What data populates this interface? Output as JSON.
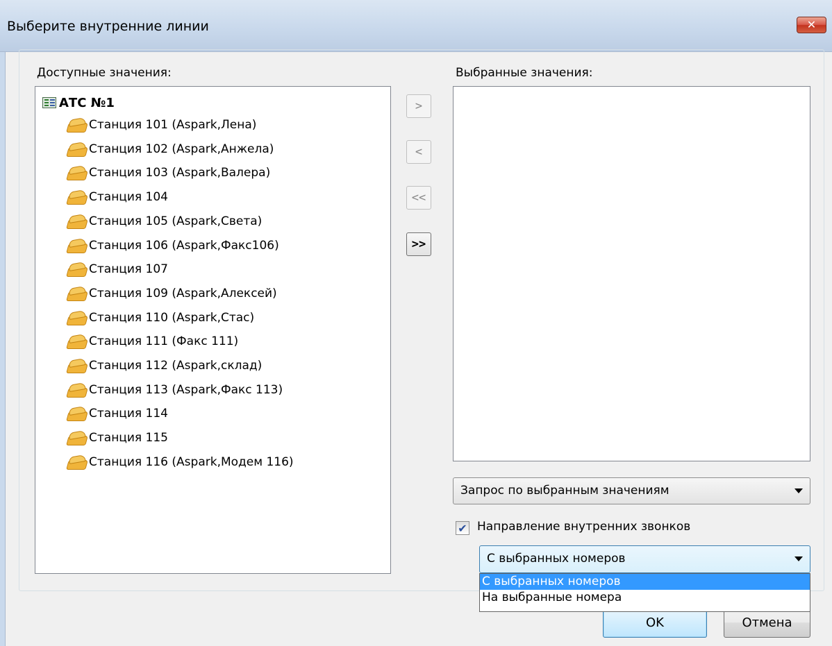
{
  "window": {
    "title": "Выберите внутренние линии",
    "close_glyph": "✕"
  },
  "available": {
    "label": "Доступные значения:",
    "root": "АТС №1",
    "items": [
      "Станция 101 (Aspark,Лена)",
      "Станция 102 (Aspark,Анжела)",
      "Станция 103 (Aspark,Валера)",
      "Станция 104",
      "Станция 105 (Aspark,Света)",
      "Станция 106 (Aspark,Факс106)",
      "Станция 107",
      "Станция 109 (Aspark,Алексей)",
      "Станция 110 (Aspark,Стас)",
      "Станция 111 (Факс 111)",
      "Станция 112 (Aspark,склад)",
      "Станция 113 (Aspark,Факс 113)",
      "Станция 114",
      "Станция 115",
      "Станция 116 (Aspark,Модем 116)"
    ],
    "item_icon": "phone-icon",
    "root_icon": "exchange-icon"
  },
  "move_buttons": {
    "add": ">",
    "remove": "<",
    "remove_all": "<<",
    "add_all": ">>"
  },
  "selected": {
    "label": "Выбранные значения:",
    "items": []
  },
  "query_combo": {
    "value": "Запрос по выбранным значениям"
  },
  "direction": {
    "checkbox_label": "Направление внутренних звонков",
    "checked": true,
    "check_glyph": "✔",
    "combo_value": "С выбранных номеров",
    "options": [
      "С выбранных номеров",
      "На выбранные номера"
    ],
    "selected_index": 0
  },
  "buttons": {
    "ok": "OK",
    "cancel": "Отмена"
  },
  "colors": {
    "selection": "#3399ff",
    "close_button": "#c4331f",
    "title_bar": "#c9d9ec"
  }
}
